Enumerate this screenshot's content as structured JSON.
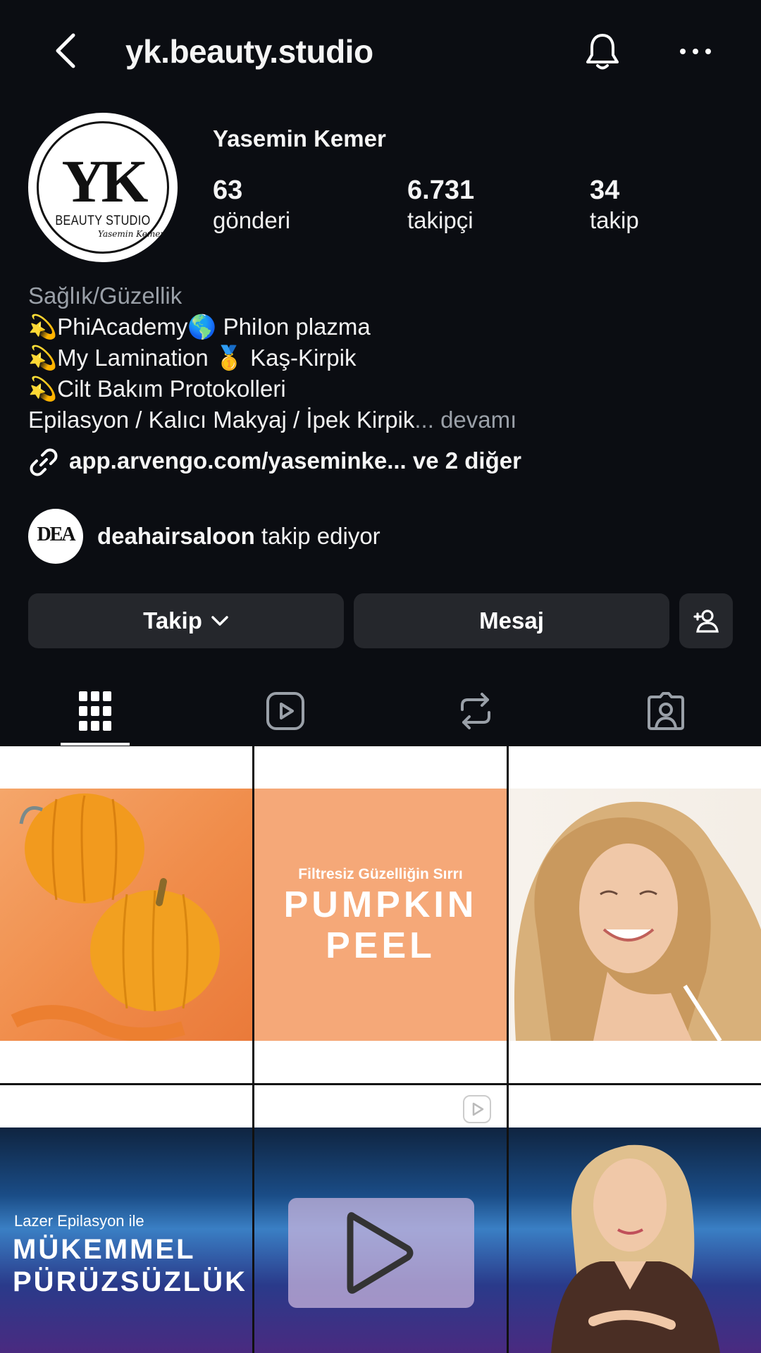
{
  "header": {
    "username": "yk.beauty.studio"
  },
  "profile": {
    "display_name": "Yasemin Kemer",
    "avatar_logo": "YK",
    "avatar_sub": "BEAUTY STUDIO",
    "avatar_signature": "Yasemin Kemer",
    "stats": [
      {
        "value": "63",
        "label": "gönderi"
      },
      {
        "value": "6.731",
        "label": "takipçi"
      },
      {
        "value": "34",
        "label": "takip"
      }
    ],
    "category": "Sağlık/Güzellik",
    "bio_lines": [
      "💫PhiAcademy🌎 PhiIon plazma",
      "💫My Lamination 🥇 Kaş-Kirpik",
      "💫Cilt Bakım Protokolleri",
      "Epilasyon / Kalıcı Makyaj / İpek Kirpik"
    ],
    "bio_more": "... devamı",
    "link_text": "app.arvengo.com/yaseminke...  ve 2 diğer",
    "mutual_avatar_text": "DEA",
    "mutual_username": "deahairsaloon",
    "mutual_suffix": " takip ediyor"
  },
  "buttons": {
    "follow": "Takip",
    "message": "Mesaj"
  },
  "tabs": [
    {
      "icon": "grid-icon",
      "active": true
    },
    {
      "icon": "reels-icon",
      "active": false
    },
    {
      "icon": "reposts-icon",
      "active": false
    },
    {
      "icon": "tagged-icon",
      "active": false
    }
  ],
  "posts": [
    {
      "type": "image",
      "subject": "pumpkins"
    },
    {
      "type": "image",
      "subtitle": "Filtresiz Güzelliğin Sırrı",
      "title_line1": "PUMPKIN",
      "title_line2": "PEEL"
    },
    {
      "type": "image",
      "subject": "smiling-woman"
    },
    {
      "type": "image",
      "subtitle": "Lazer Epilasyon ile",
      "title_line1": "MÜKEMMEL",
      "title_line2": "PÜRÜZSÜZLÜK"
    },
    {
      "type": "reel"
    },
    {
      "type": "image",
      "subject": "woman-portrait"
    }
  ],
  "colors": {
    "background": "#0b0d12",
    "button": "#25272c",
    "muted_text": "#9aa0a8"
  }
}
